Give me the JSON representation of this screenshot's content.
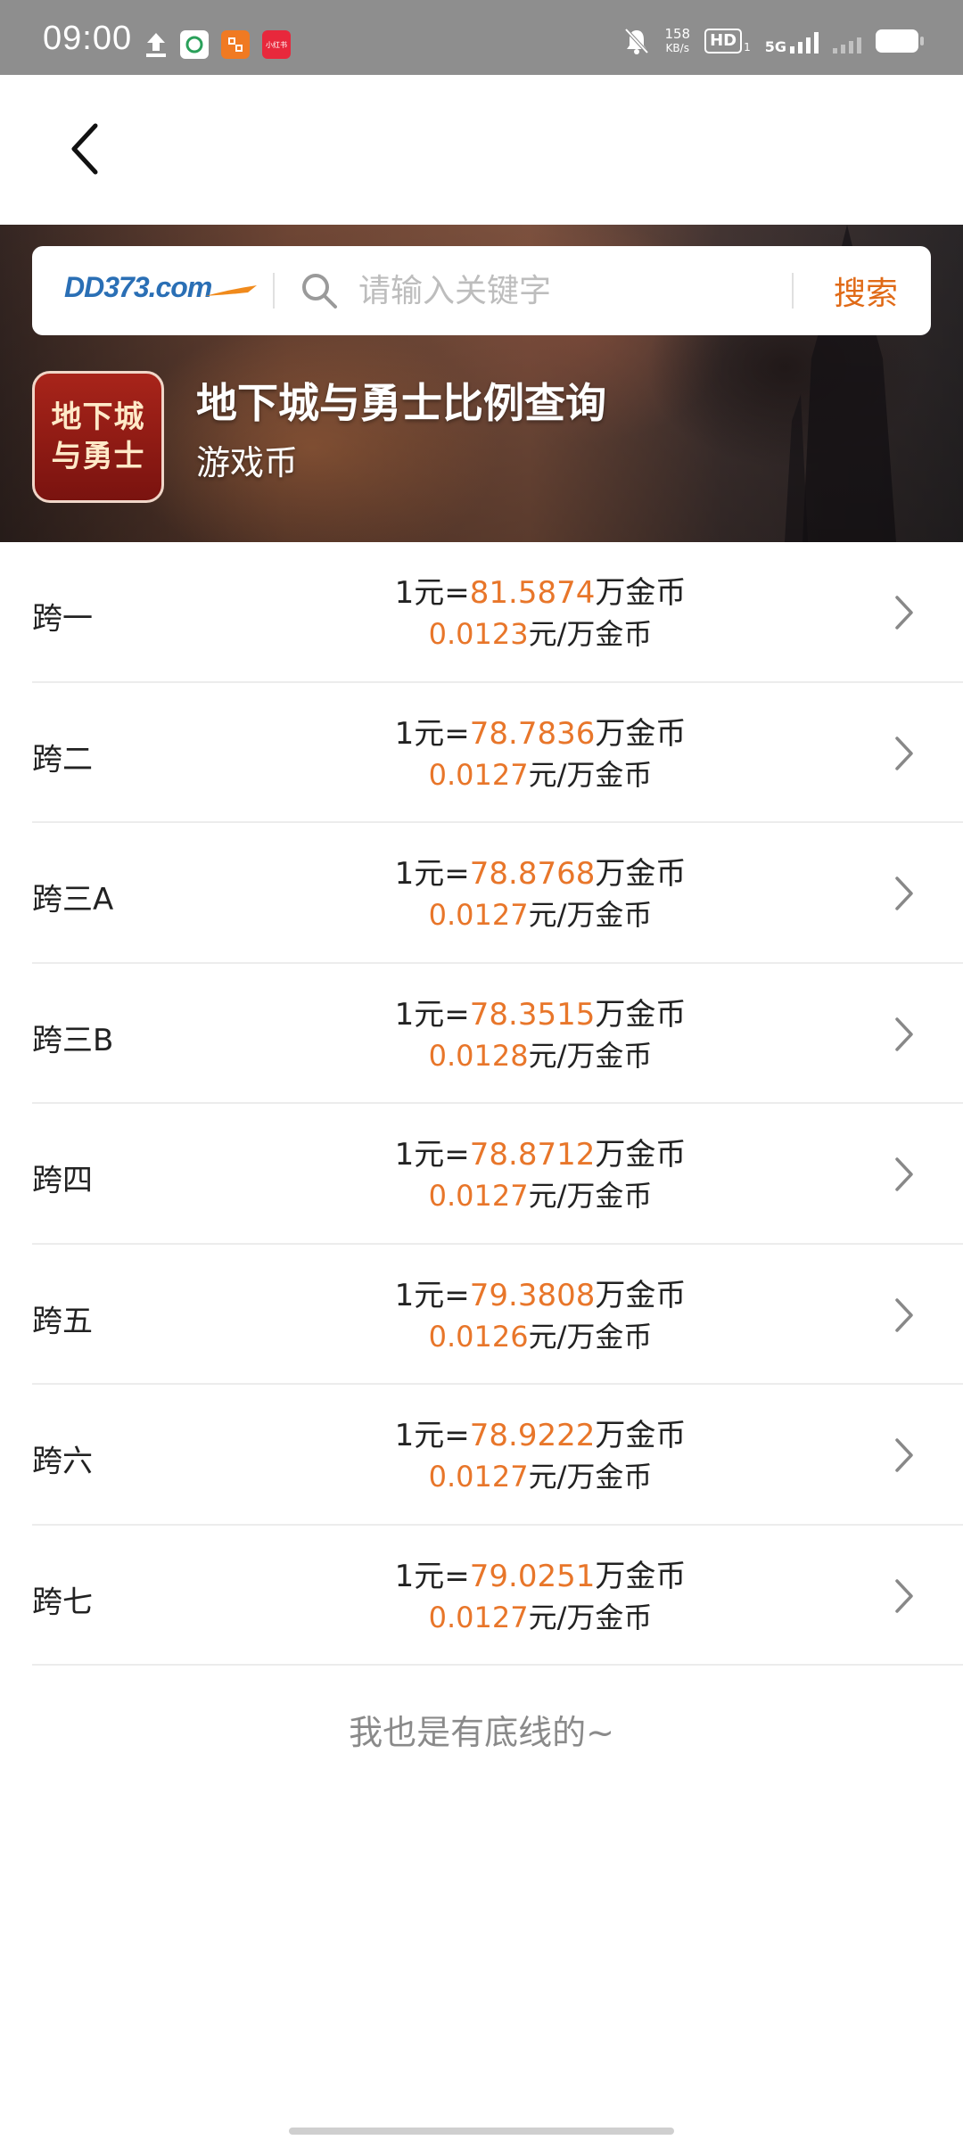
{
  "status_bar": {
    "time": "09:00",
    "net_speed_value": "158",
    "net_speed_unit": "KB/s",
    "hd_label": "HD",
    "hd_sub": "1",
    "network_type": "5G",
    "app_icon_text": "小红书",
    "icons": [
      "upload-icon",
      "sim-app-icon",
      "app-icon",
      "xiaohongshu-icon",
      "mute-bell-icon",
      "signal-icon",
      "battery-icon"
    ]
  },
  "nav": {
    "back_icon": "chevron-left-icon"
  },
  "search": {
    "logo_text": "DD373.com",
    "placeholder": "请输入关键字",
    "button_label": "搜索"
  },
  "game": {
    "logo_line1": "地下城",
    "logo_line2": "与勇士",
    "title": "地下城与勇士比例查询",
    "subtitle": "游戏币"
  },
  "rates": [
    {
      "name": "跨一",
      "prefix": "1元=",
      "rate": "81.5874",
      "rate_unit": "万金币",
      "price": "0.0123",
      "price_unit": "元/万金币"
    },
    {
      "name": "跨二",
      "prefix": "1元=",
      "rate": "78.7836",
      "rate_unit": "万金币",
      "price": "0.0127",
      "price_unit": "元/万金币"
    },
    {
      "name": "跨三A",
      "prefix": "1元=",
      "rate": "78.8768",
      "rate_unit": "万金币",
      "price": "0.0127",
      "price_unit": "元/万金币"
    },
    {
      "name": "跨三B",
      "prefix": "1元=",
      "rate": "78.3515",
      "rate_unit": "万金币",
      "price": "0.0128",
      "price_unit": "元/万金币"
    },
    {
      "name": "跨四",
      "prefix": "1元=",
      "rate": "78.8712",
      "rate_unit": "万金币",
      "price": "0.0127",
      "price_unit": "元/万金币"
    },
    {
      "name": "跨五",
      "prefix": "1元=",
      "rate": "79.3808",
      "rate_unit": "万金币",
      "price": "0.0126",
      "price_unit": "元/万金币"
    },
    {
      "name": "跨六",
      "prefix": "1元=",
      "rate": "78.9222",
      "rate_unit": "万金币",
      "price": "0.0127",
      "price_unit": "元/万金币"
    },
    {
      "name": "跨七",
      "prefix": "1元=",
      "rate": "79.0251",
      "rate_unit": "万金币",
      "price": "0.0127",
      "price_unit": "元/万金币"
    }
  ],
  "footer": {
    "note": "我也是有底线的~"
  },
  "colors": {
    "accent": "#e8762a",
    "search_button": "#e06a17",
    "logo_blue": "#2a6fb5",
    "game_logo_red": "#a8241a"
  }
}
